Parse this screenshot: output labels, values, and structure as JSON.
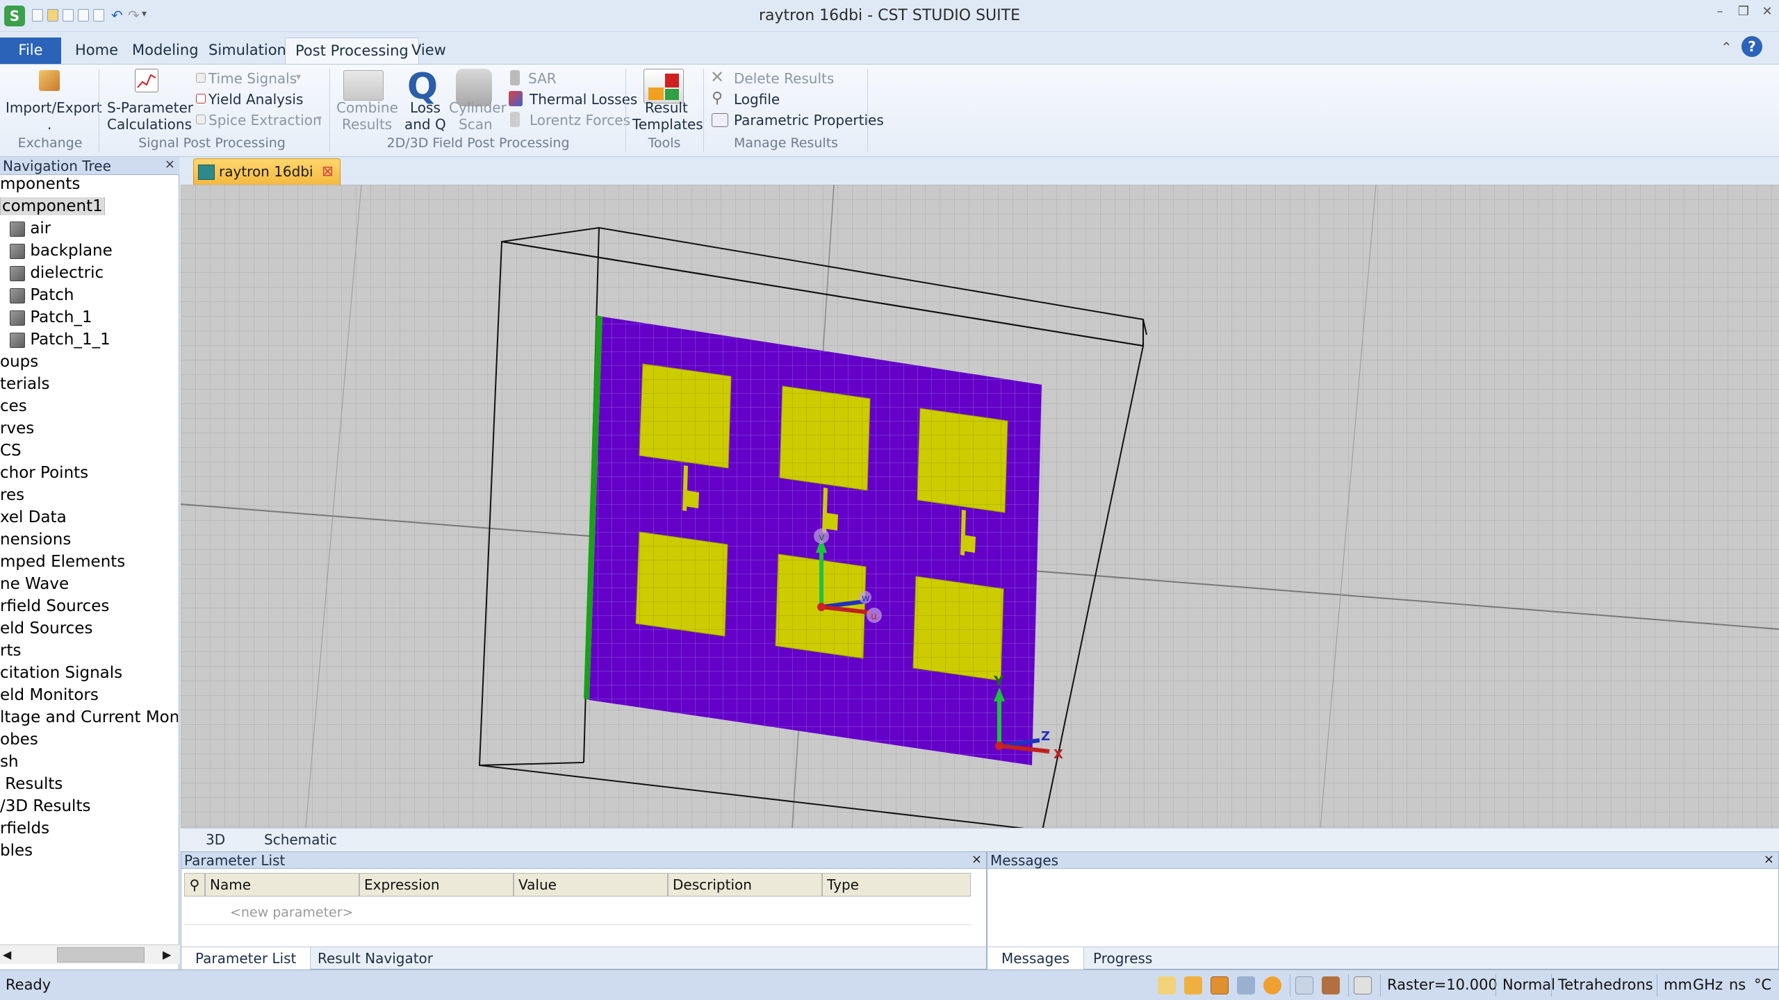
{
  "window": {
    "title": "raytron 16dbi - CST STUDIO SUITE",
    "app_icon_letter": "S"
  },
  "tabs": [
    {
      "label": "File"
    },
    {
      "label": "Home"
    },
    {
      "label": "Modeling"
    },
    {
      "label": "Simulation"
    },
    {
      "label": "Post Processing"
    },
    {
      "label": "View"
    }
  ],
  "ribbon": {
    "import_export": "Import/Export",
    "exchange_label": "Exchange",
    "sparam_line1": "S-Parameter",
    "sparam_line2": "Calculations",
    "time_signals": "Time Signals",
    "yield_analysis": "Yield Analysis",
    "spice_extraction": "Spice Extraction",
    "signal_pp_label": "Signal Post Processing",
    "combine_line1": "Combine",
    "combine_line2": "Results",
    "loss_line1": "Loss",
    "loss_line2": "and Q",
    "cyl_line1": "Cylinder",
    "cyl_line2": "Scan",
    "sar": "SAR",
    "thermal_losses": "Thermal Losses",
    "lorentz_forces": "Lorentz Forces",
    "field_pp_label": "2D/3D Field Post Processing",
    "result_line1": "Result",
    "result_line2": "Templates",
    "tools_label": "Tools",
    "delete_results": "Delete Results",
    "logfile": "Logfile",
    "parametric_properties": "Parametric Properties",
    "manage_label": "Manage Results"
  },
  "nav_tree": {
    "title": "Navigation Tree",
    "items": [
      "mponents",
      "component1",
      "air",
      "backplane",
      "dielectric",
      "Patch",
      "Patch_1",
      "Patch_1_1",
      "oups",
      "terials",
      "ces",
      "rves",
      "CS",
      "chor Points",
      "res",
      "xel Data",
      "nensions",
      "mped Elements",
      "ne Wave",
      "rfield Sources",
      "eld Sources",
      "rts",
      "citation Signals",
      "eld Monitors",
      "ltage and Current Monito",
      "obes",
      "sh",
      " Results",
      "/3D Results",
      "rfields",
      "bles"
    ]
  },
  "document": {
    "tab_title": "raytron 16dbi"
  },
  "view_tabs": [
    "3D",
    "Schematic"
  ],
  "axis_labels": {
    "w": "w",
    "u": "u",
    "y": "Y",
    "z": "Z",
    "x": "X"
  },
  "parameter_list": {
    "title": "Parameter List",
    "columns": [
      "Name",
      "Expression",
      "Value",
      "Description",
      "Type"
    ],
    "new_placeholder": "<new parameter>",
    "bottom_tabs": [
      "Parameter List",
      "Result Navigator"
    ]
  },
  "messages": {
    "title": "Messages",
    "bottom_tabs": [
      "Messages",
      "Progress"
    ]
  },
  "status": {
    "ready": "Ready",
    "raster": "Raster=10.000",
    "mode": "Normal",
    "mesh": "Tetrahedrons",
    "unit_length": "mm",
    "unit_freq": "GHz",
    "unit_time": "ns",
    "unit_temp": "°C"
  },
  "colors": {
    "substrate": "#6400c8",
    "patch": "#cccc00",
    "ribbon_accent": "#2a63b8",
    "doc_tab": "#f4b942",
    "backplane_edge": "#1aa01a"
  }
}
